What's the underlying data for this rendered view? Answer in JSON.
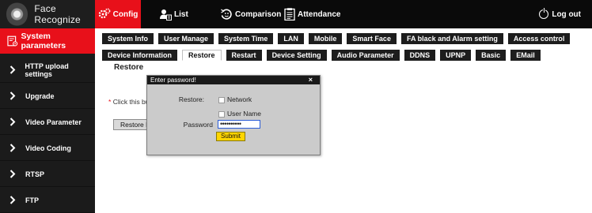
{
  "app": {
    "title": "Face Recognize"
  },
  "nav": {
    "config": "Config",
    "list": "List",
    "comparison": "Comparison",
    "attendance": "Attendance",
    "logout": "Log out"
  },
  "sidebar": {
    "active": "System parameters",
    "items": [
      {
        "label": "HTTP upload settings"
      },
      {
        "label": "Upgrade"
      },
      {
        "label": "Video Parameter"
      },
      {
        "label": "Video Coding"
      },
      {
        "label": "RTSP"
      },
      {
        "label": "FTP"
      }
    ]
  },
  "tabs": {
    "row1": [
      "System Info",
      "User Manage",
      "System Time",
      "LAN",
      "Mobile",
      "Smart Face",
      "FA black and Alarm setting",
      "Access control"
    ],
    "row2": [
      "Device Information",
      "Restore",
      "Restart",
      "Device Setting",
      "Audio Parameter",
      "DDNS",
      "UPNP",
      "Basic",
      "EMail"
    ],
    "active_row2": "Restore"
  },
  "content": {
    "title": "Restore",
    "note_star": "*",
    "note_text": "Click this but",
    "restore_button": "Restore F"
  },
  "modal": {
    "title": "Enter password!",
    "close": "×",
    "restore_label": "Restore:",
    "option_network": "Network",
    "option_username": "User Name",
    "password_label": "Password",
    "password_value": "••••••••••",
    "submit": "Submit"
  },
  "colors": {
    "accent": "#e8101a",
    "topbar": "#0a0a0a",
    "sidebar": "#1b1b1b",
    "submit": "#ffd500"
  }
}
